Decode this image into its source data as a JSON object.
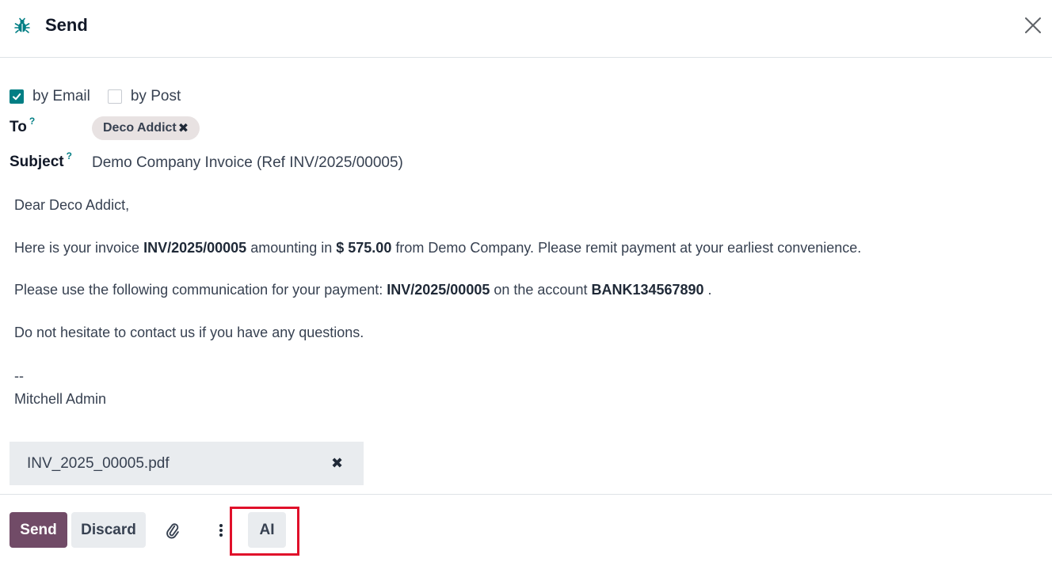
{
  "dialog": {
    "title": "Send",
    "title_icon": "bug-icon",
    "close_icon": "close-icon"
  },
  "options": {
    "by_email": {
      "label": "by Email",
      "checked": true
    },
    "by_post": {
      "label": "by Post",
      "checked": false
    }
  },
  "to": {
    "label": "To",
    "help": "?",
    "recipients": [
      {
        "name": "Deco Addict",
        "remove_icon": "times-icon"
      }
    ]
  },
  "subject": {
    "label": "Subject",
    "help": "?",
    "value": "Demo Company Invoice (Ref INV/2025/00005)"
  },
  "body": {
    "greeting": "Dear Deco Addict,",
    "line1": {
      "prefix": "Here is your invoice ",
      "invoice": "INV/2025/00005",
      "mid": " amounting in ",
      "amount": "$ 575.00",
      "suffix": " from Demo Company. Please remit payment at your earliest convenience."
    },
    "line2": {
      "prefix": "Please use the following communication for your payment: ",
      "reference": "INV/2025/00005",
      "mid": " on the account ",
      "account": "BANK134567890",
      "suffix": " ."
    },
    "line3": "Do not hesitate to contact us if you have any questions.",
    "signature_sep": "--",
    "signature": "Mitchell Admin"
  },
  "attachment": {
    "filename": "INV_2025_00005.pdf",
    "remove_icon": "times-icon"
  },
  "footer": {
    "send_label": "Send",
    "discard_label": "Discard",
    "attach_icon": "paperclip-icon",
    "more_icon": "vertical-ellipsis-icon",
    "ai_label": "AI",
    "highlight_color": "#e0102a"
  },
  "colors": {
    "primary": "#714b67",
    "accent": "#017e84"
  }
}
